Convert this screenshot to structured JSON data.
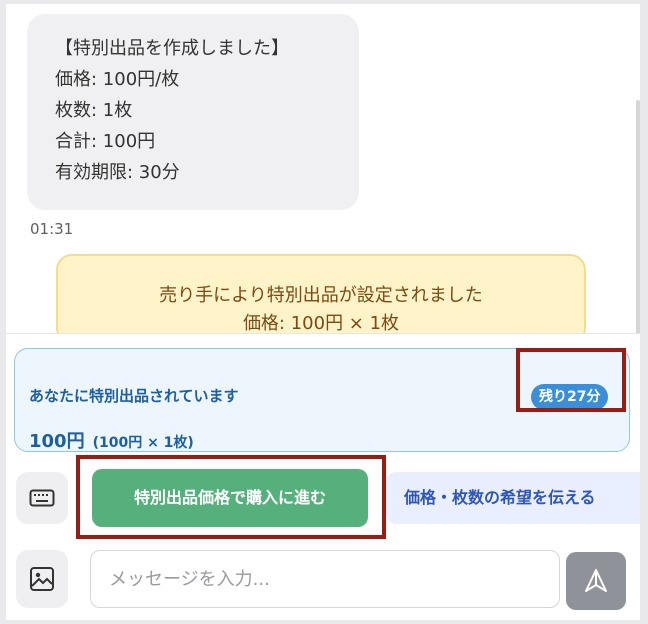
{
  "chat": {
    "seller_message": {
      "lines": [
        "【特別出品を作成しました】",
        "価格: 100円/枚",
        "枚数: 1枚",
        "合計: 100円",
        "有効期限: 30分"
      ],
      "time": "01:31"
    },
    "system_notice": {
      "lines": [
        "売り手により特別出品が設定されました",
        "価格: 100円 × 1枚"
      ]
    }
  },
  "offer_panel": {
    "title": "あなたに特別出品されています",
    "remaining_badge": "残り27分",
    "price": "100円",
    "detail": "(100円 × 1枚)"
  },
  "actions": {
    "buy_button": "特別出品価格で購入に進む",
    "request_button": "価格・枚数の希望を伝える"
  },
  "composer": {
    "placeholder": "メッセージを入力..."
  },
  "icons": {
    "keyboard": "keyboard-icon",
    "image": "image-icon",
    "send": "send-icon"
  },
  "colors": {
    "buy_button": "#55b07c",
    "offer_accent": "#1d5fa0",
    "badge": "#3b8fd9",
    "notice_bg": "#fff3c9",
    "highlight_frame": "#9c1c14"
  }
}
